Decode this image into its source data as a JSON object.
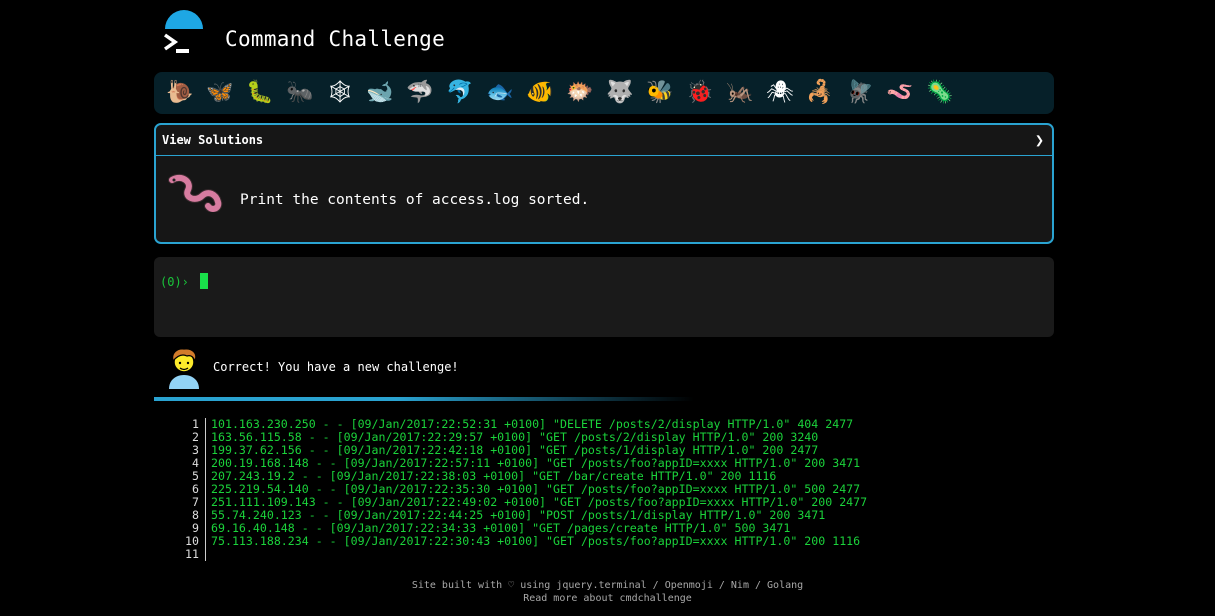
{
  "header": {
    "title": "Command Challenge"
  },
  "creatures": [
    {
      "name": "snail-icon",
      "glyph": "🐌"
    },
    {
      "name": "butterfly-icon",
      "glyph": "🦋"
    },
    {
      "name": "caterpillar-icon",
      "glyph": "🐛"
    },
    {
      "name": "ant-icon",
      "glyph": "🐜"
    },
    {
      "name": "spider-web-icon",
      "glyph": "🕸"
    },
    {
      "name": "whale-icon",
      "glyph": "🐋"
    },
    {
      "name": "shark-icon",
      "glyph": "🦈"
    },
    {
      "name": "dolphin-icon",
      "glyph": "🐬"
    },
    {
      "name": "fish-icon",
      "glyph": "🐟"
    },
    {
      "name": "tropical-fish-icon",
      "glyph": "🐠"
    },
    {
      "name": "blowfish-icon",
      "glyph": "🐡"
    },
    {
      "name": "wolf-icon",
      "glyph": "🐺"
    },
    {
      "name": "bee-icon",
      "glyph": "🐝"
    },
    {
      "name": "ladybug-icon",
      "glyph": "🐞"
    },
    {
      "name": "cricket-icon",
      "glyph": "🦗"
    },
    {
      "name": "spider-icon",
      "glyph": "🕷"
    },
    {
      "name": "scorpion-icon",
      "glyph": "🦂"
    },
    {
      "name": "fly-icon",
      "glyph": "🪰"
    },
    {
      "name": "worm-icon",
      "glyph": "🪱"
    },
    {
      "name": "microbe-icon",
      "glyph": "🦠"
    }
  ],
  "panel": {
    "header_label": "View Solutions",
    "chevron": "❯",
    "challenge": "Print the contents of access.log sorted."
  },
  "terminal": {
    "prompt": "(0)›"
  },
  "result": {
    "message": "Correct! You have a new challenge!"
  },
  "output": {
    "lines": [
      {
        "n": "1",
        "text": "101.163.230.250 - - [09/Jan/2017:22:52:31 +0100] \"DELETE /posts/2/display HTTP/1.0\" 404 2477"
      },
      {
        "n": "2",
        "text": "163.56.115.58 - - [09/Jan/2017:22:29:57 +0100] \"GET /posts/2/display HTTP/1.0\" 200 3240"
      },
      {
        "n": "3",
        "text": "199.37.62.156 - - [09/Jan/2017:22:42:18 +0100] \"GET /posts/1/display HTTP/1.0\" 200 2477"
      },
      {
        "n": "4",
        "text": "200.19.168.148 - - [09/Jan/2017:22:57:11 +0100] \"GET /posts/foo?appID=xxxx HTTP/1.0\" 200 3471"
      },
      {
        "n": "5",
        "text": "207.243.19.2 - - [09/Jan/2017:22:38:03 +0100] \"GET /bar/create HTTP/1.0\" 200 1116"
      },
      {
        "n": "6",
        "text": "225.219.54.140 - - [09/Jan/2017:22:35:30 +0100] \"GET /posts/foo?appID=xxxx HTTP/1.0\" 500 2477"
      },
      {
        "n": "7",
        "text": "251.111.109.143 - - [09/Jan/2017:22:49:02 +0100] \"GET /posts/foo?appID=xxxx HTTP/1.0\" 200 2477"
      },
      {
        "n": "8",
        "text": "55.74.240.123 - - [09/Jan/2017:22:44:25 +0100] \"POST /posts/1/display HTTP/1.0\" 200 3471"
      },
      {
        "n": "9",
        "text": "69.16.40.148 - - [09/Jan/2017:22:34:33 +0100] \"GET /pages/create HTTP/1.0\" 500 3471"
      },
      {
        "n": "10",
        "text": "75.113.188.234 - - [09/Jan/2017:22:30:43 +0100] \"GET /posts/foo?appID=xxxx HTTP/1.0\" 200 1116"
      },
      {
        "n": "11",
        "text": ""
      }
    ]
  },
  "footer": {
    "line1": "Site built with ♡ using jquery.terminal / Openmoji / Nim / Golang",
    "line2": "Read more about cmdchallenge"
  },
  "colors": {
    "accent": "#2aa3d1",
    "terminal_green": "#1bd33b",
    "creature_bar_bg": "#062029"
  }
}
